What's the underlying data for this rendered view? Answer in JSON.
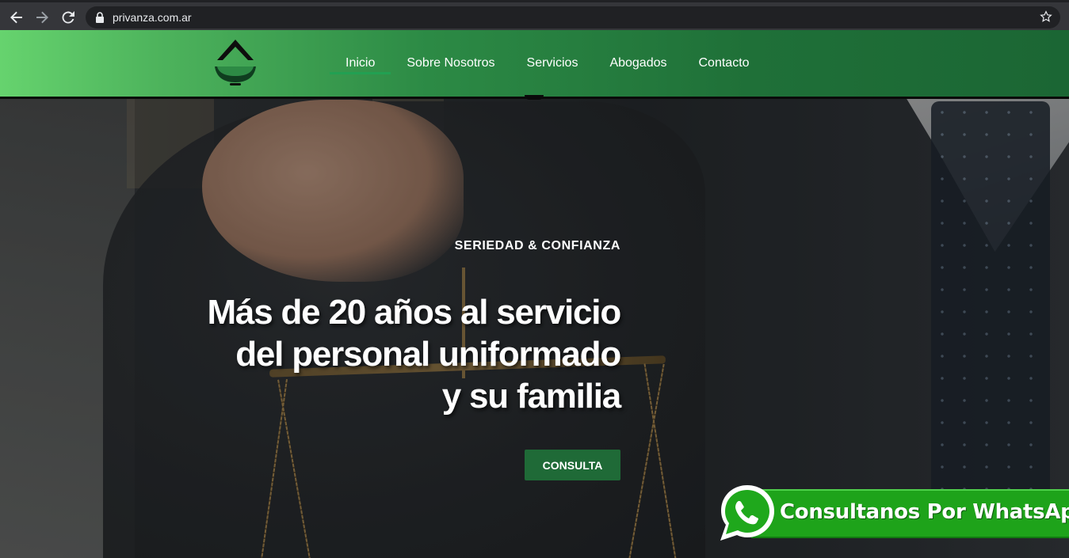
{
  "browser": {
    "url": "privanza.com.ar",
    "icons": [
      "back-arrow-icon",
      "forward-arrow-icon",
      "reload-icon",
      "lock-icon",
      "bookmark-star-icon"
    ]
  },
  "header": {
    "nav": [
      {
        "label": "Inicio",
        "active": true
      },
      {
        "label": "Sobre Nosotros"
      },
      {
        "label": "Servicios"
      },
      {
        "label": "Abogados"
      },
      {
        "label": "Contacto"
      }
    ],
    "colors": {
      "gradient_start": "#66d36e",
      "gradient_end": "#1b6634",
      "active_underline": "#22a052"
    }
  },
  "hero": {
    "tagline": "SERIEDAD & CONFIANZA",
    "headline": [
      "Más de 20 años al servicio",
      "del personal uniformado",
      "y su familia"
    ],
    "cta_label": "CONSULTA",
    "cta_color": "#1f6a37"
  },
  "whatsapp": {
    "label": "Consultanos Por WhatsApp",
    "color": "#1ea31a"
  }
}
